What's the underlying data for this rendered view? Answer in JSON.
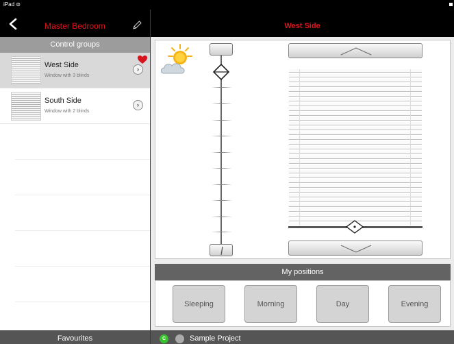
{
  "status": {
    "device": "iPad ⊜"
  },
  "left_nav": {
    "title": "Master Bedroom"
  },
  "right_nav": {
    "title": "West Side"
  },
  "control_groups": {
    "header": "Control groups",
    "items": [
      {
        "name": "West Side",
        "subtitle": "Window with 3 blinds",
        "selected": true,
        "favourite": true
      },
      {
        "name": "South Side",
        "subtitle": "Window with 2 blinds",
        "selected": false,
        "favourite": false
      }
    ]
  },
  "positions": {
    "header": "My positions",
    "buttons": [
      "Sleeping",
      "Morning",
      "Day",
      "Evening"
    ]
  },
  "favourites_label": "Favourites",
  "project": {
    "name": "Sample Project",
    "connected_badge": "C"
  },
  "colors": {
    "title_red": "#e0131c",
    "connected_green": "#39c22b",
    "heart_red": "#d7141d"
  },
  "icons": [
    "back-chevron-icon",
    "pencil-icon",
    "heart-icon",
    "chevron-right-icon",
    "weather-sun-cloud-icon",
    "diamond-handle-icon"
  ]
}
